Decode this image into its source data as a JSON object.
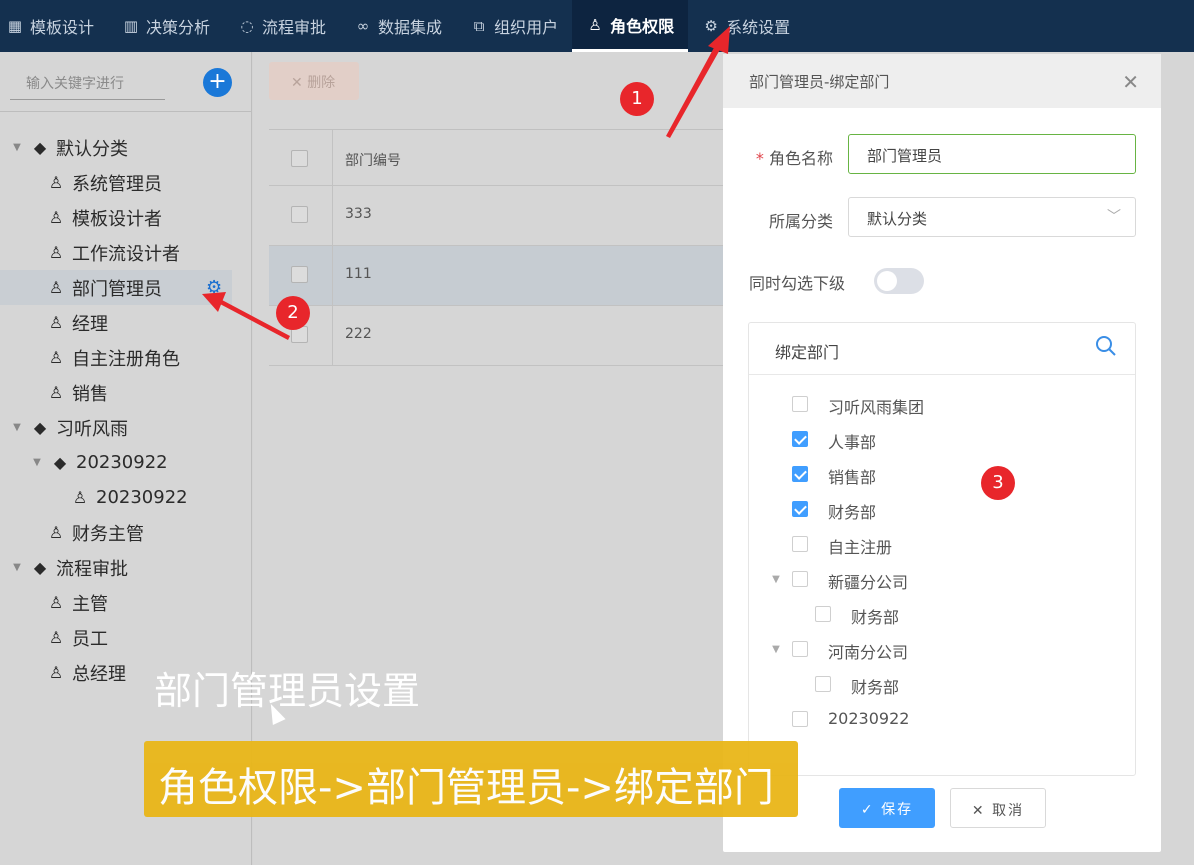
{
  "topnav": {
    "items": [
      {
        "label": "模板设计",
        "icon": "grid-icon"
      },
      {
        "label": "决策分析",
        "icon": "bar-chart-icon"
      },
      {
        "label": "流程审批",
        "icon": "cycle-icon"
      },
      {
        "label": "数据集成",
        "icon": "link-icon"
      },
      {
        "label": "组织用户",
        "icon": "org-tree-icon"
      },
      {
        "label": "角色权限",
        "icon": "user-icon",
        "active": true
      },
      {
        "label": "系统设置",
        "icon": "gear-icon"
      }
    ]
  },
  "sidebar": {
    "search_placeholder": "输入关键字进行",
    "add_label": "+",
    "tree": [
      {
        "label": "默认分类",
        "type": "group",
        "level": 0,
        "expanded": true
      },
      {
        "label": "系统管理员",
        "type": "role",
        "level": 1
      },
      {
        "label": "模板设计者",
        "type": "role",
        "level": 1
      },
      {
        "label": "工作流设计者",
        "type": "role",
        "level": 1
      },
      {
        "label": "部门管理员",
        "type": "role",
        "level": 1,
        "selected": true
      },
      {
        "label": "经理",
        "type": "role",
        "level": 1
      },
      {
        "label": "自主注册角色",
        "type": "role",
        "level": 1
      },
      {
        "label": "销售",
        "type": "role",
        "level": 1
      },
      {
        "label": "习听风雨",
        "type": "group",
        "level": 0,
        "expanded": true
      },
      {
        "label": "20230922",
        "type": "group",
        "level": 1,
        "expanded": true
      },
      {
        "label": "20230922",
        "type": "role",
        "level": 2
      },
      {
        "label": "财务主管",
        "type": "role",
        "level": 1
      },
      {
        "label": "流程审批",
        "type": "group",
        "level": 0,
        "expanded": true
      },
      {
        "label": "主管",
        "type": "role",
        "level": 1
      },
      {
        "label": "员工",
        "type": "role",
        "level": 1
      },
      {
        "label": "总经理",
        "type": "role",
        "level": 1
      }
    ]
  },
  "main": {
    "delete_label": "删除",
    "table": {
      "header": "部门编号",
      "rows": [
        "333",
        "111",
        "222"
      ]
    }
  },
  "dialog": {
    "title": "部门管理员-绑定部门",
    "role_name_label": "角色名称",
    "role_name_value": "部门管理员",
    "category_label": "所属分类",
    "category_value": "默认分类",
    "cascade_label": "同时勾选下级",
    "cascade_on": false,
    "bind_dept_label": "绑定部门",
    "departments": [
      {
        "label": "习听风雨集团",
        "checked": false,
        "level": 0,
        "caret": false
      },
      {
        "label": "人事部",
        "checked": true,
        "level": 0,
        "caret": false
      },
      {
        "label": "销售部",
        "checked": true,
        "level": 0,
        "caret": false
      },
      {
        "label": "财务部",
        "checked": true,
        "level": 0,
        "caret": false
      },
      {
        "label": "自主注册",
        "checked": false,
        "level": 0,
        "caret": false
      },
      {
        "label": "新疆分公司",
        "checked": false,
        "level": 0,
        "caret": true
      },
      {
        "label": "财务部",
        "checked": false,
        "level": 1,
        "caret": false
      },
      {
        "label": "河南分公司",
        "checked": false,
        "level": 0,
        "caret": true
      },
      {
        "label": "财务部",
        "checked": false,
        "level": 1,
        "caret": false
      },
      {
        "label": "20230922",
        "checked": false,
        "level": 0,
        "caret": false
      }
    ],
    "save_label": "保存",
    "cancel_label": "取消"
  },
  "annotations": {
    "badge1": "1",
    "badge2": "2",
    "badge3": "3",
    "caption_white": "部门管理员设置",
    "caption_yellow": "角色权限->部门管理员->绑定部门",
    "badge_color": "#e8262b",
    "caption_bar_color": "#e9b618"
  }
}
